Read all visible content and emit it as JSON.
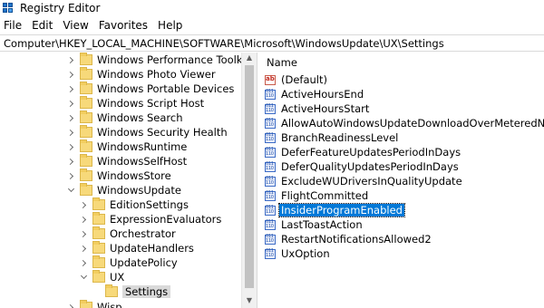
{
  "window": {
    "title": "Registry Editor"
  },
  "menu": [
    "File",
    "Edit",
    "View",
    "Favorites",
    "Help"
  ],
  "address": "Computer\\HKEY_LOCAL_MACHINE\\SOFTWARE\\Microsoft\\WindowsUpdate\\UX\\Settings",
  "tree": {
    "items": [
      {
        "label": "Windows Performance Toolkit",
        "state": "collapsed"
      },
      {
        "label": "Windows Photo Viewer",
        "state": "collapsed"
      },
      {
        "label": "Windows Portable Devices",
        "state": "collapsed"
      },
      {
        "label": "Windows Script Host",
        "state": "collapsed"
      },
      {
        "label": "Windows Search",
        "state": "collapsed"
      },
      {
        "label": "Windows Security Health",
        "state": "collapsed"
      },
      {
        "label": "WindowsRuntime",
        "state": "collapsed"
      },
      {
        "label": "WindowsSelfHost",
        "state": "collapsed"
      },
      {
        "label": "WindowsStore",
        "state": "collapsed"
      },
      {
        "label": "WindowsUpdate",
        "state": "expanded"
      },
      {
        "label": "EditionSettings",
        "state": "collapsed"
      },
      {
        "label": "ExpressionEvaluators",
        "state": "collapsed"
      },
      {
        "label": "Orchestrator",
        "state": "collapsed"
      },
      {
        "label": "UpdateHandlers",
        "state": "collapsed"
      },
      {
        "label": "UpdatePolicy",
        "state": "collapsed"
      },
      {
        "label": "UX",
        "state": "expanded"
      },
      {
        "label": "Settings",
        "state": "leaf",
        "selected": true
      },
      {
        "label": "Wisp",
        "state": "collapsed"
      }
    ]
  },
  "values_pane": {
    "column_header": "Name",
    "items": [
      {
        "name": "(Default)",
        "type": "string"
      },
      {
        "name": "ActiveHoursEnd",
        "type": "dword"
      },
      {
        "name": "ActiveHoursStart",
        "type": "dword"
      },
      {
        "name": "AllowAutoWindowsUpdateDownloadOverMeteredNetwork",
        "type": "dword"
      },
      {
        "name": "BranchReadinessLevel",
        "type": "dword"
      },
      {
        "name": "DeferFeatureUpdatesPeriodInDays",
        "type": "dword"
      },
      {
        "name": "DeferQualityUpdatesPeriodInDays",
        "type": "dword"
      },
      {
        "name": "ExcludeWUDriversInQualityUpdate",
        "type": "dword"
      },
      {
        "name": "FlightCommitted",
        "type": "dword"
      },
      {
        "name": "InsiderProgramEnabled",
        "type": "dword",
        "selected": true
      },
      {
        "name": "LastToastAction",
        "type": "dword"
      },
      {
        "name": "RestartNotificationsAllowed2",
        "type": "dword"
      },
      {
        "name": "UxOption",
        "type": "dword"
      }
    ]
  },
  "colors": {
    "selection": "#0078d7",
    "folder": "#f7d97a",
    "tree_selection": "#d9d9d9"
  }
}
